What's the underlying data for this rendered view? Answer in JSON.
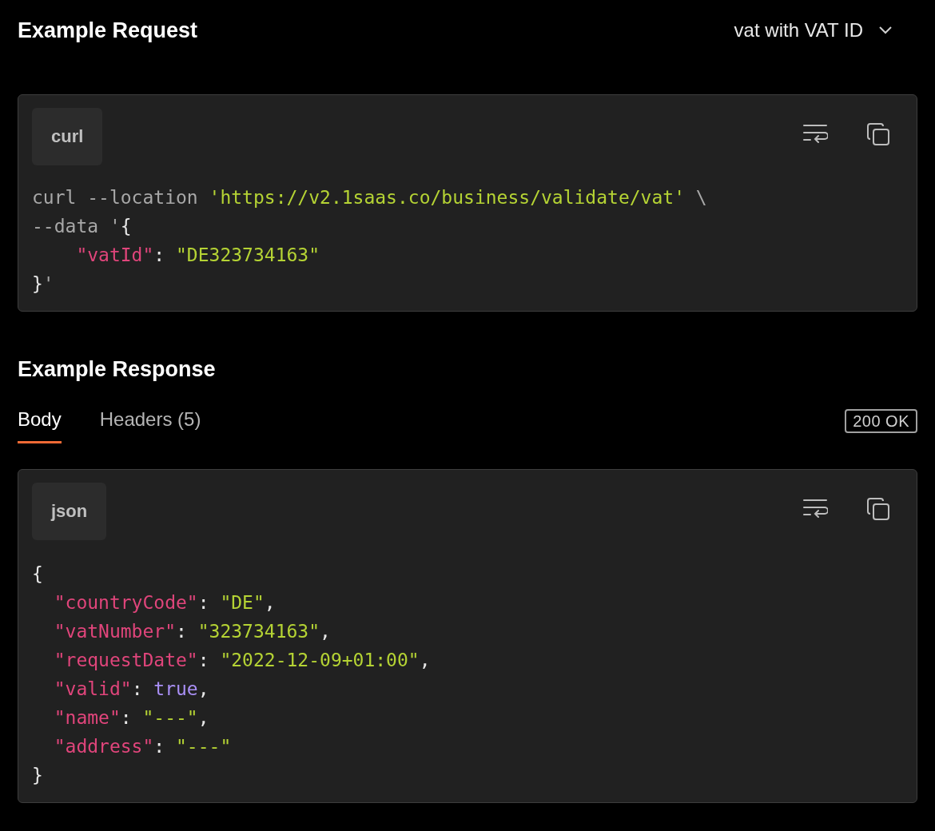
{
  "request": {
    "title": "Example Request",
    "selector": "vat with VAT ID",
    "language": "curl",
    "lines": [
      {
        "indented": false,
        "tokens": [
          {
            "kind": "plain",
            "text": "curl --location "
          },
          {
            "kind": "string",
            "text": "'https://v2.1saas.co/business/validate/vat'"
          },
          {
            "kind": "plain",
            "text": " \\"
          }
        ]
      },
      {
        "indented": false,
        "tokens": [
          {
            "kind": "plain",
            "text": "--data '"
          },
          {
            "kind": "punct",
            "text": "{"
          }
        ]
      },
      {
        "indented": true,
        "tokens": [
          {
            "kind": "key",
            "text": "\"vatId\""
          },
          {
            "kind": "punct",
            "text": ": "
          },
          {
            "kind": "string",
            "text": "\"DE323734163\""
          }
        ]
      },
      {
        "indented": false,
        "tokens": [
          {
            "kind": "punct",
            "text": "}"
          },
          {
            "kind": "plain",
            "text": "'"
          }
        ]
      }
    ]
  },
  "response": {
    "title": "Example Response",
    "tabs": [
      {
        "label": "Body",
        "selected": true
      },
      {
        "label": "Headers (5)",
        "selected": false
      }
    ],
    "status": "200 OK",
    "language": "json",
    "lines": [
      {
        "indented": false,
        "tokens": [
          {
            "kind": "punct",
            "text": "{"
          }
        ]
      },
      {
        "indented": true,
        "tokens": [
          {
            "kind": "key",
            "text": "\"countryCode\""
          },
          {
            "kind": "punct",
            "text": ": "
          },
          {
            "kind": "string",
            "text": "\"DE\""
          },
          {
            "kind": "punct",
            "text": ","
          }
        ]
      },
      {
        "indented": true,
        "tokens": [
          {
            "kind": "key",
            "text": "\"vatNumber\""
          },
          {
            "kind": "punct",
            "text": ": "
          },
          {
            "kind": "string",
            "text": "\"323734163\""
          },
          {
            "kind": "punct",
            "text": ","
          }
        ]
      },
      {
        "indented": true,
        "tokens": [
          {
            "kind": "key",
            "text": "\"requestDate\""
          },
          {
            "kind": "punct",
            "text": ": "
          },
          {
            "kind": "string",
            "text": "\"2022-12-09+01:00\""
          },
          {
            "kind": "punct",
            "text": ","
          }
        ]
      },
      {
        "indented": true,
        "tokens": [
          {
            "kind": "key",
            "text": "\"valid\""
          },
          {
            "kind": "punct",
            "text": ": "
          },
          {
            "kind": "keyword",
            "text": "true"
          },
          {
            "kind": "punct",
            "text": ","
          }
        ]
      },
      {
        "indented": true,
        "tokens": [
          {
            "kind": "key",
            "text": "\"name\""
          },
          {
            "kind": "punct",
            "text": ": "
          },
          {
            "kind": "string",
            "text": "\"---\""
          },
          {
            "kind": "punct",
            "text": ","
          }
        ]
      },
      {
        "indented": true,
        "tokens": [
          {
            "kind": "key",
            "text": "\"address\""
          },
          {
            "kind": "punct",
            "text": ": "
          },
          {
            "kind": "string",
            "text": "\"---\""
          }
        ]
      },
      {
        "indented": false,
        "tokens": [
          {
            "kind": "punct",
            "text": "}"
          }
        ]
      }
    ]
  }
}
